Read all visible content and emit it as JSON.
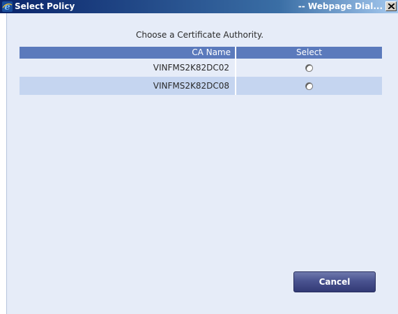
{
  "window": {
    "title": "Select Policy",
    "title_suffix": "-- Webpage Dial..."
  },
  "dialog": {
    "instruction": "Choose a Certificate Authority.",
    "columns": [
      "CA Name",
      "Select"
    ],
    "rows": [
      {
        "ca_name": "VINFMS2K82DC02",
        "selected": false
      },
      {
        "ca_name": "VINFMS2K82DC08",
        "selected": false
      }
    ],
    "cancel_label": "Cancel"
  },
  "colors": {
    "header_bg": "#5b7abc",
    "alt_row_bg": "#c5d5f0",
    "content_bg": "#e6ecf8",
    "button_bg": "#4a5390"
  },
  "icons": {
    "app": "internet-explorer-icon",
    "close": "close-icon"
  }
}
